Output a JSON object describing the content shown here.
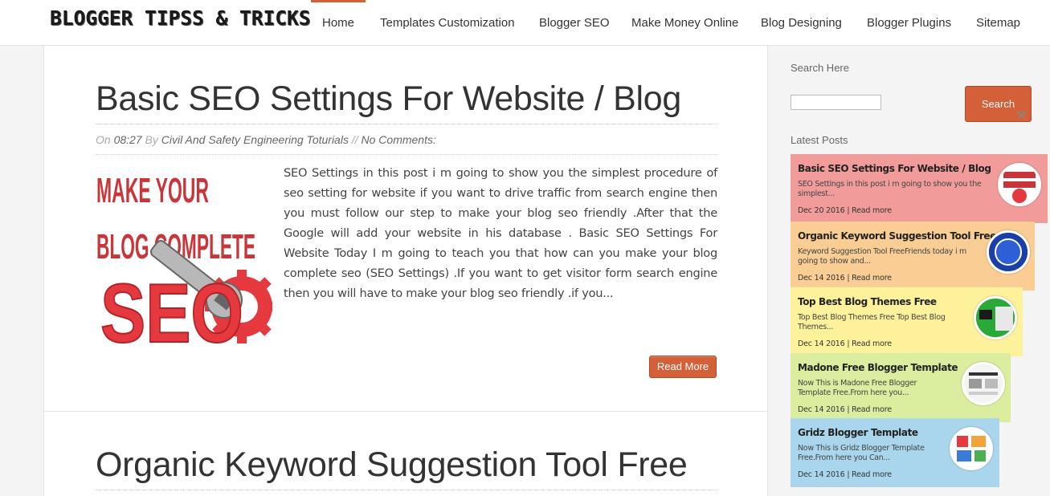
{
  "site": {
    "logo_text": "BLOGGER TIPSS & TRICKS"
  },
  "nav": {
    "items": [
      {
        "label": "Home",
        "active": true
      },
      {
        "label": "Templates Customization"
      },
      {
        "label": "Blogger SEO"
      },
      {
        "label": "Make Money Online"
      },
      {
        "label": "Blog Designing"
      },
      {
        "label": "Blogger Plugins"
      },
      {
        "label": "Sitemap"
      }
    ]
  },
  "posts": [
    {
      "title": "Basic SEO Settings For Website / Blog",
      "meta": {
        "on_label": "On",
        "time": "08:27",
        "by_label": "By",
        "author": "Civil And Safety Engineering Toturials",
        "separator": "//",
        "comments": "No Comments:"
      },
      "thumbnail": {
        "line1": "MAKE YOUR",
        "line2": "BLOG COMPLETE",
        "line3": "SEO"
      },
      "excerpt": "SEO Settings in this post i m going to show you the simplest procedure of seo setting for website if you want to drive traffic from search engine then you must follow our step to make your blog seo friendly .After that the Google will add your website in his database . Basic SEO Settings For Website Today I m going to teach you that how can you make your blog complete seo (SEO Settings) .If you want to get visitor form search engine then you will have to make your blog seo friendly .if you...",
      "read_more": "Read More"
    },
    {
      "title": "Organic Keyword Suggestion Tool Free"
    }
  ],
  "sidebar": {
    "search_title": "Search Here",
    "search_placeholder": "",
    "search_button": "Search",
    "latest_title": "Latest Posts",
    "latest_posts": [
      {
        "title": "Basic SEO Settings For Website / Blog",
        "snippet": "SEO Settings in this post i m going to show you the simplest...",
        "date": "Dec 20 2016",
        "read_more": "Read more",
        "color": "#f29b9b"
      },
      {
        "title": "Organic Keyword Suggestion Tool Free",
        "snippet": "Keyword Suggestion Tool FreeFriends today i m going to show and...",
        "date": "Dec 14 2016",
        "read_more": "Read more",
        "color": "#f9cd93"
      },
      {
        "title": "Top Best Blog Themes Free",
        "snippet": "Top Best Blog Themes Free Top Best Blog Themes...",
        "date": "Dec 14 2016",
        "read_more": "Read more",
        "color": "#fdf29b"
      },
      {
        "title": "Madone Free Blogger Template",
        "snippet": "Now This is Madone Free Blogger Template Free.From here you...",
        "date": "Dec 14 2016",
        "read_more": "Read more",
        "color": "#dbee9f"
      },
      {
        "title": "Gridz Blogger Template",
        "snippet": "Now This is Gridz Blogger Template Free.From here you Can...",
        "date": "Dec 14 2016",
        "read_more": "Read more",
        "color": "#a9d6ec"
      }
    ]
  },
  "colors": {
    "accent": "#d4603a"
  }
}
